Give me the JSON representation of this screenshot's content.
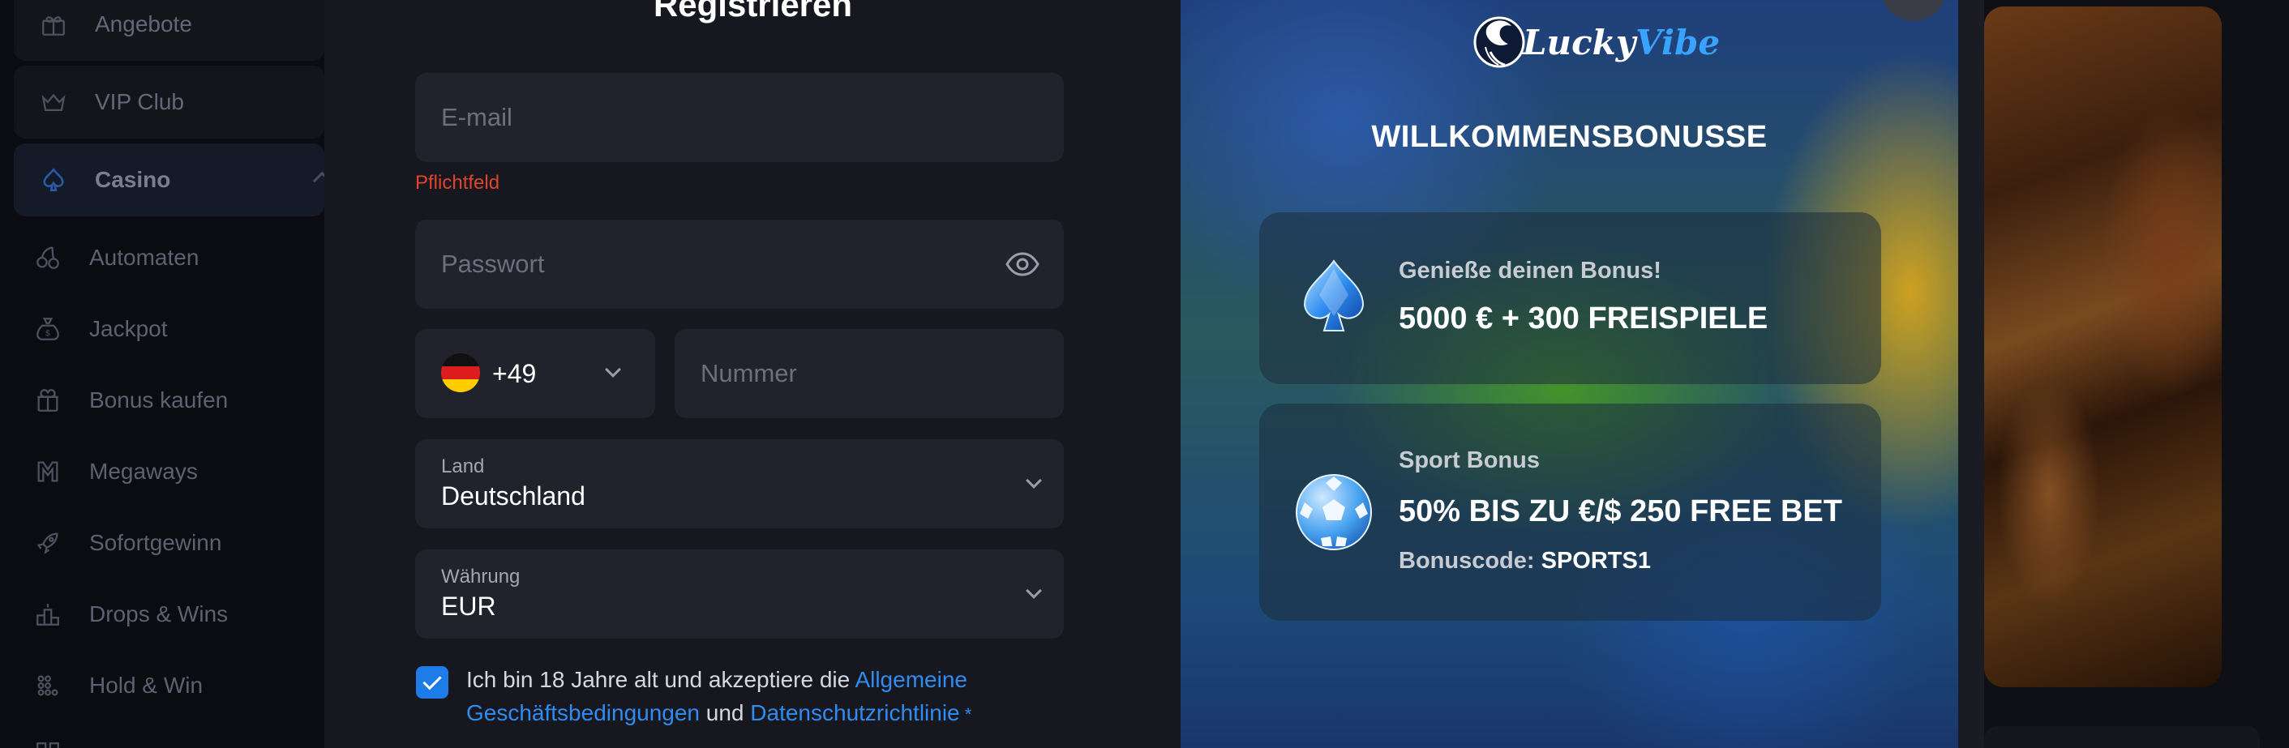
{
  "sidebar": {
    "top_items": [
      {
        "label": "Angebote",
        "icon": "gift-icon"
      },
      {
        "label": "VIP Club",
        "icon": "crown-icon"
      },
      {
        "label": "Casino",
        "icon": "spade-icon"
      }
    ],
    "items": [
      {
        "label": "Automaten",
        "icon": "cherries-icon"
      },
      {
        "label": "Jackpot",
        "icon": "money-bag-icon"
      },
      {
        "label": "Bonus kaufen",
        "icon": "gift-box-icon"
      },
      {
        "label": "Megaways",
        "icon": "megaways-icon"
      },
      {
        "label": "Sofortgewinn",
        "icon": "rocket-icon"
      },
      {
        "label": "Drops & Wins",
        "icon": "podium-icon"
      },
      {
        "label": "Hold & Win",
        "icon": "grid-dots-icon"
      }
    ]
  },
  "form": {
    "title": "Registrieren",
    "email": {
      "placeholder": "E-mail",
      "error": "Pflichtfeld"
    },
    "password": {
      "placeholder": "Passwort"
    },
    "phone": {
      "code": "+49",
      "placeholder": "Nummer"
    },
    "country": {
      "label": "Land",
      "value": "Deutschland"
    },
    "currency": {
      "label": "Währung",
      "value": "EUR"
    },
    "terms": {
      "text_before": "Ich bin 18 Jahre alt und akzeptiere die ",
      "link1": "Allgemeine Geschäftsbedingungen",
      "text_between": " und ",
      "link2": "Datenschutzrichtlinie",
      "required_mark": " *"
    }
  },
  "bonus": {
    "logo_text_white": "Lucky",
    "logo_text_blue": "Vibe",
    "heading": "WILLKOMMENSBONUSSE",
    "cards": [
      {
        "subtitle": "Genieße deinen Bonus!",
        "main": "5000 € + 300 FREISPIELE",
        "icon": "spade-gem-icon"
      },
      {
        "subtitle": "Sport Bonus",
        "main": "50% BIS ZU €/$ 250 FREE BET",
        "code_label": "Bonuscode: ",
        "code": "SPORTS1",
        "icon": "soccer-ball-icon"
      }
    ]
  },
  "colors": {
    "accent_blue": "#2f8cf0",
    "error": "#e0442c",
    "checkbox": "#1e7ce8"
  }
}
